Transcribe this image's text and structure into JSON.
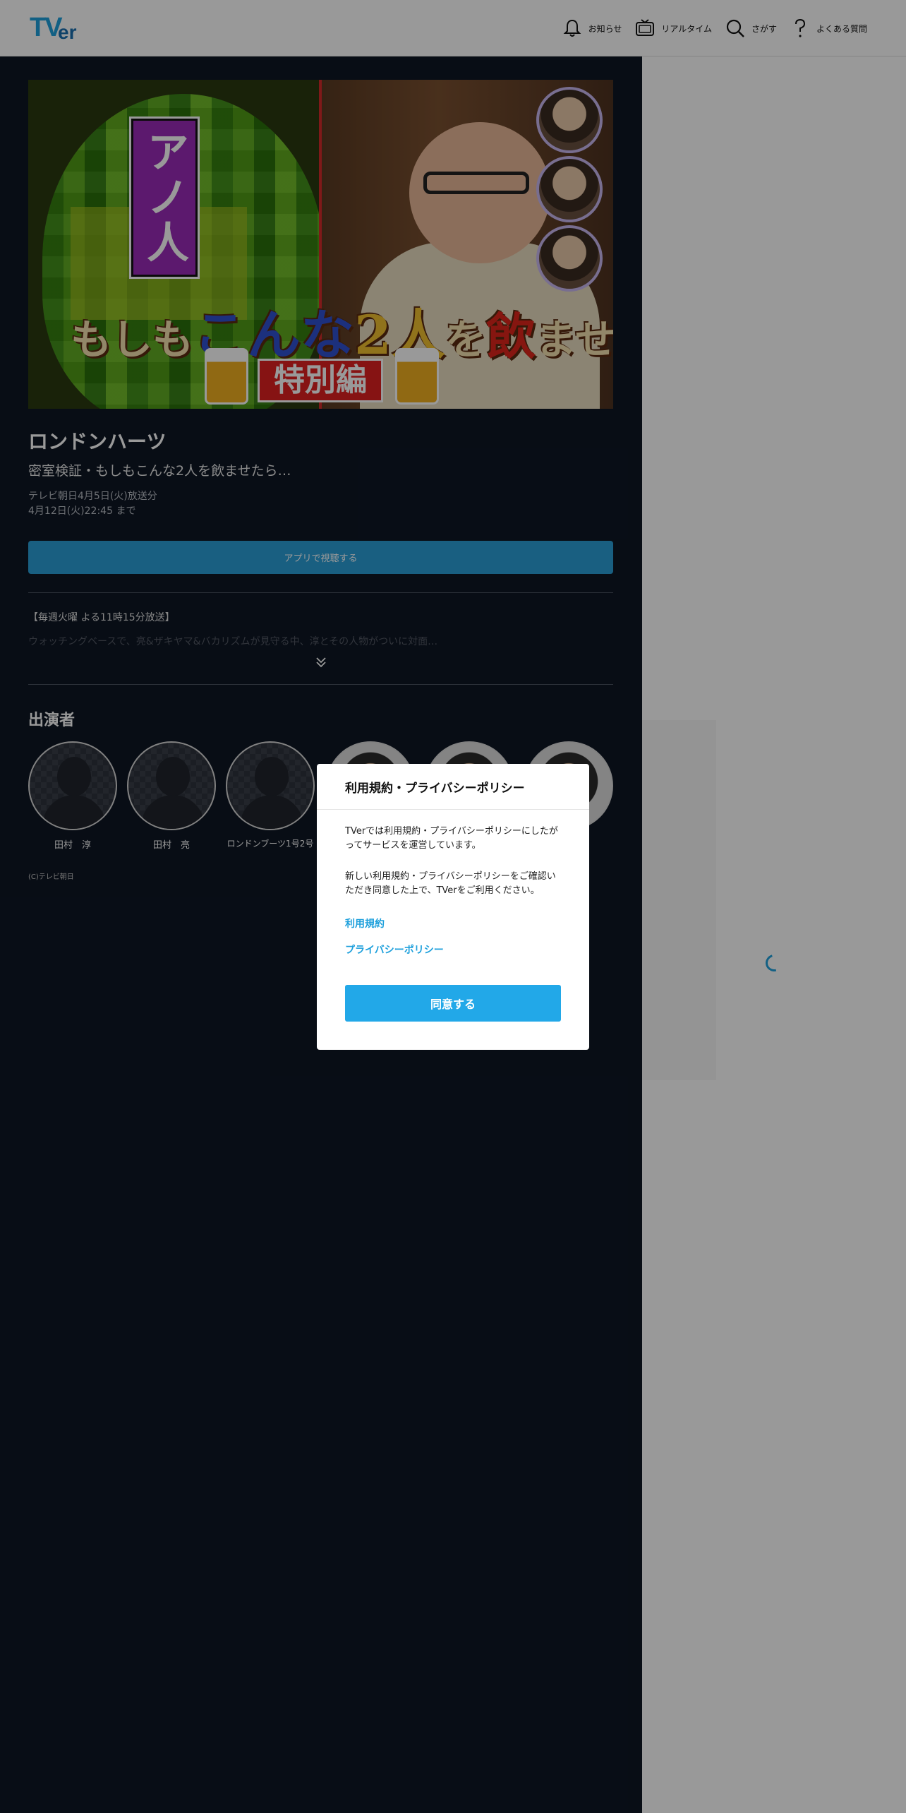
{
  "header": {
    "logo": "TVer",
    "nav": [
      {
        "label": "お知らせ",
        "icon": "bell-icon"
      },
      {
        "label": "リアルタイム",
        "icon": "tv-icon"
      },
      {
        "label": "さがす",
        "icon": "search-icon"
      },
      {
        "label": "よくある質問",
        "icon": "question-icon"
      }
    ]
  },
  "episode": {
    "thumbnail": {
      "ano_label": "アノ人",
      "title_part1": "もしも",
      "title_part2": "こんな",
      "title_part3": "2人",
      "title_part4": "を",
      "title_part5": "飲",
      "title_part6": "ませたら…",
      "tag": "特別編"
    },
    "show_title": "ロンドンハーツ",
    "episode_title": "密室検証・もしもこんな2人を飲ませたら…",
    "broadcast": "テレビ朝日4月5日(火)放送分",
    "available_until": "4月12日(火)22:45 まで",
    "app_button": "アプリで視聴する",
    "description_line1": "【毎週火曜 よる11時15分放送】",
    "description_line2": "ウォッチングベースで、亮&ザキヤマ&バカリズムが見守る中、淳とその人物がついに対面…",
    "cast_heading": "出演者",
    "cast": [
      {
        "name": "田村　淳",
        "photo": false
      },
      {
        "name": "田村　亮",
        "photo": false
      },
      {
        "name": "ロンドンブーツ1号2号",
        "photo": false
      },
      {
        "name": "",
        "photo": true
      },
      {
        "name": "",
        "photo": true
      },
      {
        "name": "",
        "photo": true
      }
    ],
    "copyright": "(C)テレビ朝日"
  },
  "modal": {
    "title": "利用規約・プライバシーポリシー",
    "p1": "TVerでは利用規約・プライバシーポリシーにしたがってサービスを運営しています。",
    "p2": "新しい利用規約・プライバシーポリシーをご確認いただき同意した上で、TVerをご利用ください。",
    "link_terms": "利用規約",
    "link_privacy": "プライバシーポリシー",
    "agree": "同意する"
  },
  "colors": {
    "accent": "#22a8e8",
    "main_bg": "#0e1624"
  }
}
